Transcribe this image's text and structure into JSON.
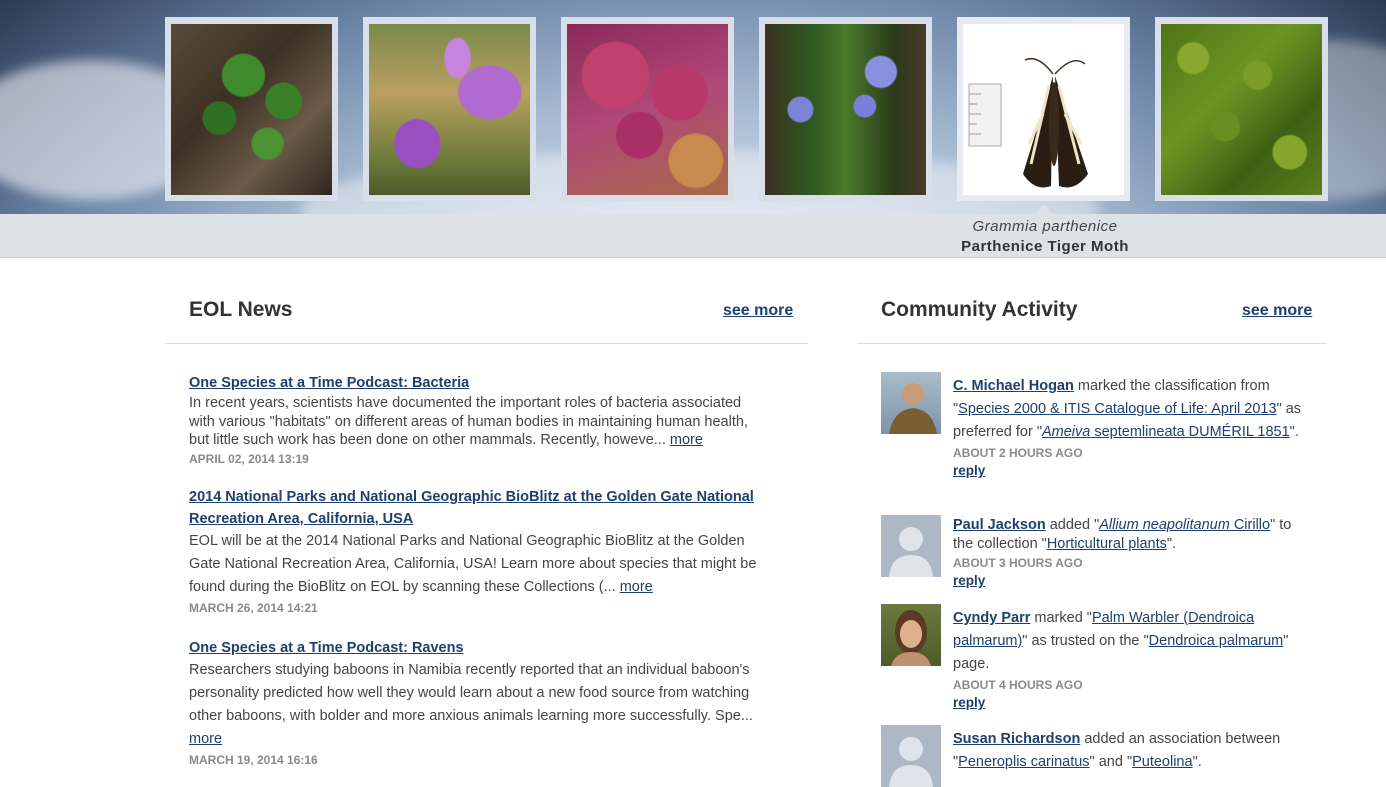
{
  "carousel": {
    "items": [
      {
        "icon": "plant-leaves-photo"
      },
      {
        "icon": "purple-flower-photo"
      },
      {
        "icon": "coral-photo"
      },
      {
        "icon": "blue-flower-photo"
      },
      {
        "icon": "moth-photo"
      },
      {
        "icon": "moss-photo"
      }
    ],
    "active_scientific": "Grammia parthenice",
    "active_common": "Parthenice Tiger Moth"
  },
  "news": {
    "heading": "EOL News",
    "see_more": "see more",
    "items": [
      {
        "title": "One Species at a Time Podcast: Bacteria",
        "body": "In recent years, scientists have documented the important roles of bacteria associated with various \"habitats\" on different areas of human bodies in maintaining human health, but little such work has been done on other mammals. Recently, howeve...",
        "more": "more",
        "date": "APRIL 02, 2014 13:19"
      },
      {
        "title": "2014 National Parks and National Geographic BioBlitz at the Golden Gate National Recreation Area, California, USA",
        "body": "EOL will be at the 2014 National Parks and National Geographic BioBlitz at the Golden Gate National Recreation Area, California, USA! Learn more about species that might be found during the BioBlitz on EOL by scanning these Collections (...",
        "more": "more",
        "date": "MARCH 26, 2014 14:21"
      },
      {
        "title": "One Species at a Time Podcast: Ravens",
        "body": "Researchers studying baboons in Namibia recently reported that an individual baboon's personality predicted how well they would learn about a new food source from watching other baboons, with bolder and more anxious animals learning more successfully. Spe...",
        "more": "more",
        "date": "MARCH 19, 2014 16:16"
      }
    ]
  },
  "community": {
    "heading": "Community Activity",
    "see_more": "see more",
    "items": [
      {
        "user": "C. Michael Hogan",
        "t1": " marked the classification from \"",
        "l1": "Species 2000 & ITIS Catalogue of Life: April 2013",
        "t2": "\" as preferred for \"",
        "l2_italic": "Ameiva",
        "l2": " septemlineata DUMÉRIL 1851",
        "t3": "\".",
        "ago": "ABOUT 2 HOURS AGO",
        "reply": "reply"
      },
      {
        "user": "Paul Jackson",
        "t1": " added \"",
        "l1_italic": "Allium neapolitanum",
        "l1": " Cirillo",
        "t2": "\" to the collection \"",
        "l2": "Horticultural plants",
        "t3": "\".",
        "ago": "ABOUT 3 HOURS AGO",
        "reply": "reply"
      },
      {
        "user": "Cyndy Parr",
        "t1": " marked \"",
        "l1": "Palm Warbler (Dendroica palmarum)",
        "t2": "\" as trusted on the \"",
        "l2": "Dendroica palmarum",
        "t3": "\" page.",
        "ago": "ABOUT 4 HOURS AGO",
        "reply": "reply"
      },
      {
        "user": "Susan Richardson",
        "t1": " added an association between \"",
        "l1": "Peneroplis carinatus",
        "t2": "\" and \"",
        "l2": "Puteolina",
        "t3": "\"."
      }
    ]
  }
}
